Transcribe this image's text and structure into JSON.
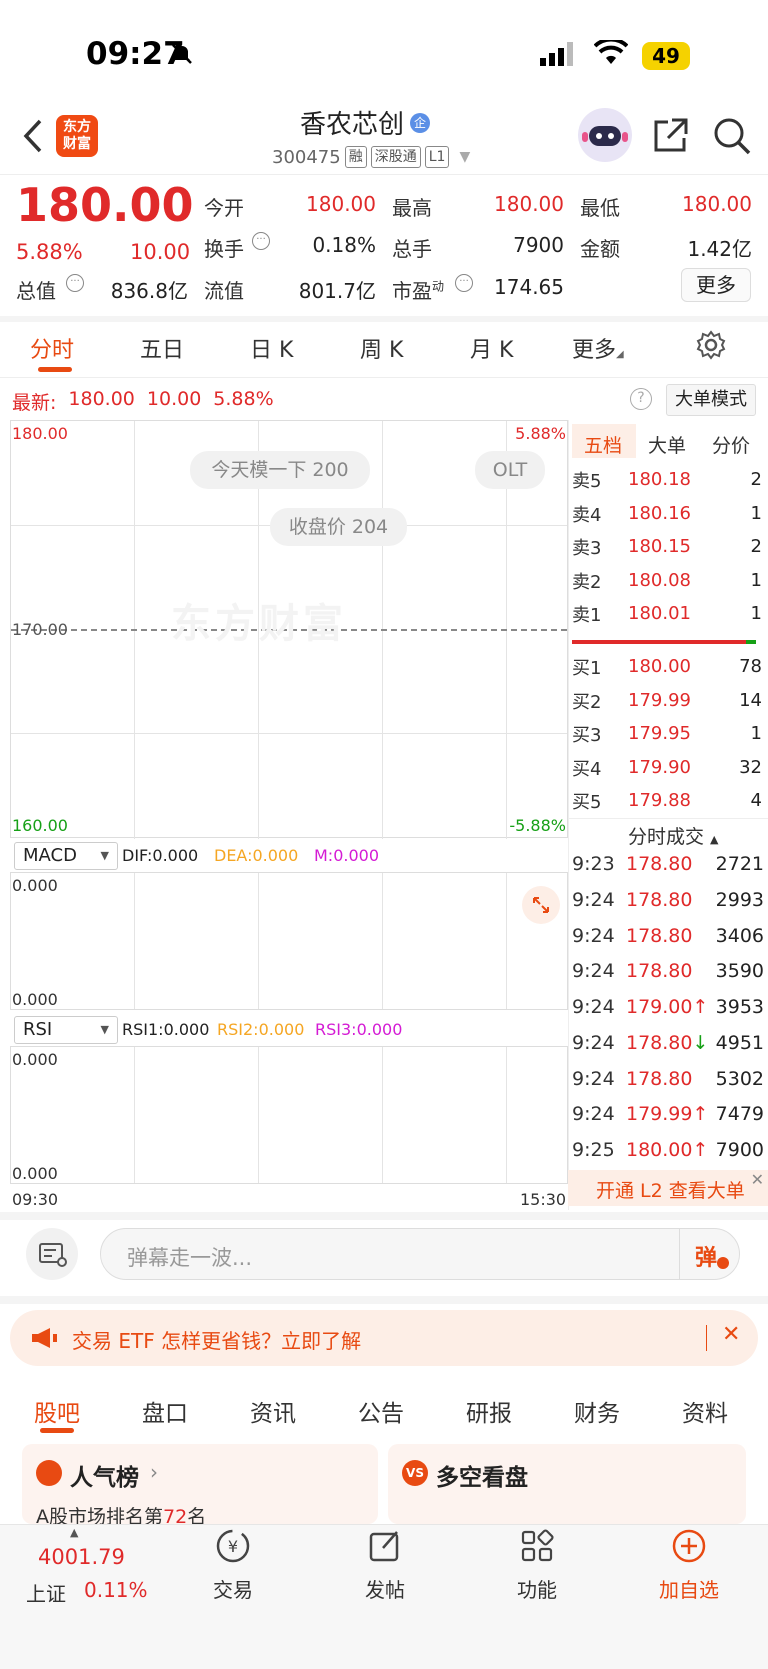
{
  "status_bar": {
    "time": "09:27",
    "battery": "49"
  },
  "header": {
    "logo_line1": "东方",
    "logo_line2": "财富",
    "stock_name": "香农芯创",
    "badge_qi": "企",
    "stock_code": "300475",
    "tags": [
      "融",
      "深股通",
      "L1"
    ]
  },
  "quote": {
    "price": "180.00",
    "change_pct": "5.88%",
    "change_amt": "10.00",
    "fields": {
      "open_label": "今开",
      "open": "180.00",
      "high_label": "最高",
      "high": "180.00",
      "low_label": "最低",
      "low": "180.00",
      "turnover_label": "换手",
      "turnover": "0.18%",
      "volume_label": "总手",
      "volume": "7900",
      "amount_label": "金额",
      "amount": "1.42亿",
      "mcap_label": "总值",
      "mcap": "836.8亿",
      "float_label": "流值",
      "float": "801.7亿",
      "pe_label": "市盈",
      "pe_sup": "动",
      "pe": "174.65"
    },
    "more_label": "更多"
  },
  "tabs": [
    "分时",
    "五日",
    "日 K",
    "周 K",
    "月 K",
    "更多"
  ],
  "latest_bar": {
    "label": "最新:",
    "price": "180.00",
    "change": "10.00",
    "pct": "5.88%",
    "big_order_mode": "大单模式"
  },
  "chart": {
    "y_top": "180.00",
    "y_mid": "170.00",
    "y_bottom": "160.00",
    "pct_top": "5.88%",
    "pct_bottom": "-5.88%",
    "bubble_1": "今天模一下 200",
    "bubble_2": "OLT",
    "bubble_3": "收盘价 204",
    "watermark": "东方财富",
    "time_start": "09:30",
    "time_end": "15:30"
  },
  "macd": {
    "name": "MACD",
    "dif": "DIF:0.000",
    "dea": "DEA:0.000",
    "m": "M:0.000",
    "top": "0.000",
    "bottom": "0.000"
  },
  "rsi": {
    "name": "RSI",
    "rsi1": "RSI1:0.000",
    "rsi2": "RSI2:0.000",
    "rsi3": "RSI3:0.000",
    "top": "0.000",
    "bottom": "0.000"
  },
  "orderbook": {
    "tabs": [
      "五档",
      "大单",
      "分价"
    ],
    "asks": [
      {
        "label": "卖5",
        "price": "180.18",
        "vol": "2"
      },
      {
        "label": "卖4",
        "price": "180.16",
        "vol": "1"
      },
      {
        "label": "卖3",
        "price": "180.15",
        "vol": "2"
      },
      {
        "label": "卖2",
        "price": "180.08",
        "vol": "1"
      },
      {
        "label": "卖1",
        "price": "180.01",
        "vol": "1"
      }
    ],
    "bids": [
      {
        "label": "买1",
        "price": "180.00",
        "vol": "78"
      },
      {
        "label": "买2",
        "price": "179.99",
        "vol": "14"
      },
      {
        "label": "买3",
        "price": "179.95",
        "vol": "1"
      },
      {
        "label": "买4",
        "price": "179.90",
        "vol": "32"
      },
      {
        "label": "买5",
        "price": "179.88",
        "vol": "4"
      }
    ],
    "trades_title": "分时成交",
    "trades": [
      {
        "time": "9:23",
        "price": "178.80",
        "arrow": "",
        "vol": "2721"
      },
      {
        "time": "9:24",
        "price": "178.80",
        "arrow": "",
        "vol": "2993"
      },
      {
        "time": "9:24",
        "price": "178.80",
        "arrow": "",
        "vol": "3406"
      },
      {
        "time": "9:24",
        "price": "178.80",
        "arrow": "",
        "vol": "3590"
      },
      {
        "time": "9:24",
        "price": "179.00",
        "arrow": "↑",
        "vol": "3953"
      },
      {
        "time": "9:24",
        "price": "178.80",
        "arrow": "↓",
        "vol": "4951"
      },
      {
        "time": "9:24",
        "price": "178.80",
        "arrow": "",
        "vol": "5302"
      },
      {
        "time": "9:24",
        "price": "179.99",
        "arrow": "↑",
        "vol": "7479"
      },
      {
        "time": "9:25",
        "price": "180.00",
        "arrow": "↑",
        "vol": "7900"
      }
    ],
    "l2_promo": "开通 L2 查看大单"
  },
  "danmaku": {
    "placeholder": "弹幕走一波...",
    "send": "弹"
  },
  "banner": {
    "text": "交易 ETF 怎样更省钱？立即了解"
  },
  "section_tabs": [
    "股吧",
    "盘口",
    "资讯",
    "公告",
    "研报",
    "财务",
    "资料"
  ],
  "cards": {
    "popularity_title": "人气榜",
    "popularity_sub_prefix": "A股市场排名第",
    "popularity_rank": "72",
    "popularity_sub_suffix": "名",
    "bullbear_title": "多空看盘"
  },
  "bottom_nav": {
    "index_value": "4001.79",
    "index_name": "上证",
    "index_pct": "0.11%",
    "trade": "交易",
    "post": "发帖",
    "features": "功能",
    "add_watch": "加自选"
  },
  "colors": {
    "up": "#e02a2a",
    "down": "#16a016",
    "accent": "#e84a12"
  }
}
